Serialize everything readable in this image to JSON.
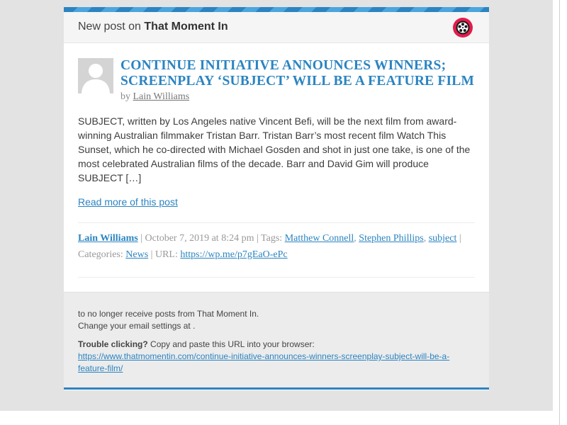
{
  "header": {
    "prefix": "New post on",
    "site_name": "That Moment In",
    "site_icon": "film-reel-icon"
  },
  "post": {
    "title_line1": "CONTINUE INITIATIVE ANNOUNCES WINNERS;",
    "title_line2": "SCREENPLAY ‘SUBJECT’ WILL BE A FEATURE FILM",
    "by_label": "by",
    "author": "Lain Williams",
    "excerpt": "SUBJECT, written by Los Angeles native Vincent Befi, will be the next film from award-winning Australian filmmaker Tristan Barr. Tristan Barr’s most recent film Watch This Sunset, which he co-directed with Michael Gosden and shot in just one take, is one of the most celebrated Australian films of the decade. Barr and David Gim will produce SUBJECT […]",
    "read_more": "Read more of this post"
  },
  "meta": {
    "author": "Lain Williams",
    "date": "October 7, 2019 at 8:24 pm",
    "tags_label": "Tags:",
    "tags": [
      "Matthew Connell",
      "Stephen Phillips",
      "subject"
    ],
    "categories_label": "Categories:",
    "category": "News",
    "url_label": "URL:",
    "url": "https://wp.me/p7gEaO-ePc"
  },
  "footer": {
    "unsubscribe": "to no longer receive posts from That Moment In.",
    "settings": "Change your email settings at .",
    "trouble_label": "Trouble clicking?",
    "trouble_text": "Copy and paste this URL into your browser:",
    "url_line1": "https://www.thatmomentin.com/continue-initiative-announces-winners-screenplay-subject-will-be-a-",
    "url_line2": "feature-film/"
  },
  "colors": {
    "accent": "#2b84c1",
    "site_icon_bg": "#e21b4b"
  }
}
